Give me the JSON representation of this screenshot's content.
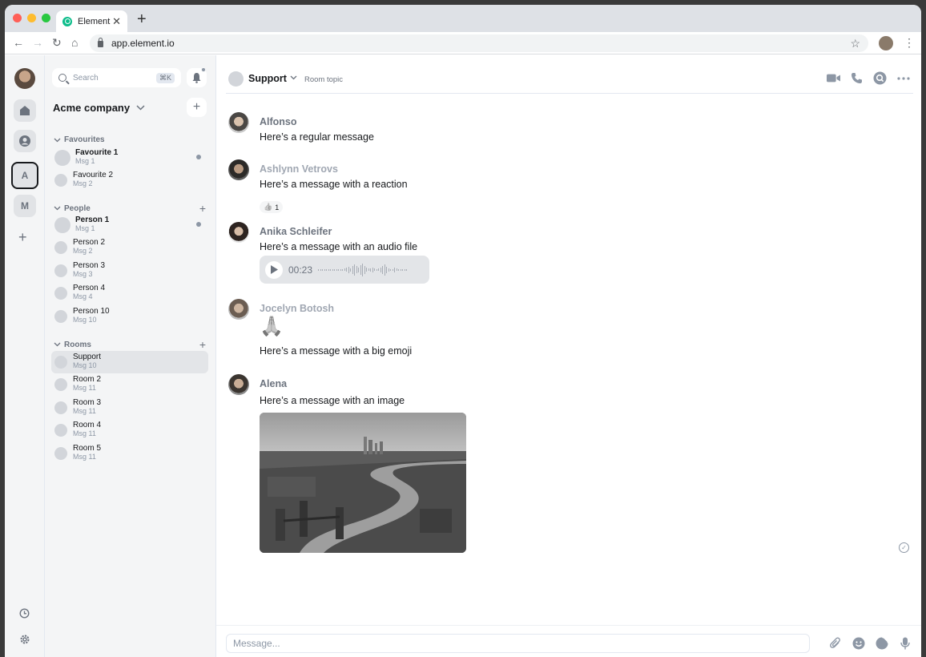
{
  "browser": {
    "tab_title": "Element",
    "tab_close": "✕",
    "new_tab": "+",
    "url": "app.element.io",
    "traffic_lights": [
      "#ff5f57",
      "#febc2e",
      "#28c840"
    ]
  },
  "spaces": {
    "items": [
      {
        "label": "A"
      },
      {
        "label": "M"
      }
    ],
    "add": "+"
  },
  "sidebar": {
    "search_placeholder": "Search",
    "search_shortcut": "⌘K",
    "space_name": "Acme company",
    "sections": {
      "favourites": "Favourites",
      "people": "People",
      "rooms": "Rooms"
    },
    "favourites": [
      {
        "name": "Favourite 1",
        "msg": "Msg 1"
      },
      {
        "name": "Favourite 2",
        "msg": "Msg 2"
      }
    ],
    "people": [
      {
        "name": "Person 1",
        "msg": "Msg 1"
      },
      {
        "name": "Person 2",
        "msg": "Msg 2"
      },
      {
        "name": "Person 3",
        "msg": "Msg 3"
      },
      {
        "name": "Person 4",
        "msg": "Msg 4"
      },
      {
        "name": "Person 10",
        "msg": "Msg 10"
      }
    ],
    "rooms": [
      {
        "name": "Support",
        "msg": "Msg 10"
      },
      {
        "name": "Room 2",
        "msg": "Msg 11"
      },
      {
        "name": "Room 3",
        "msg": "Msg 11"
      },
      {
        "name": "Room 4",
        "msg": "Msg 11"
      },
      {
        "name": "Room 5",
        "msg": "Msg 11"
      }
    ]
  },
  "room": {
    "name": "Support",
    "topic": "Room topic"
  },
  "messages": [
    {
      "sender": "Alfonso",
      "body": "Here’s a regular message"
    },
    {
      "sender": "Ashlynn Vetrovs",
      "body": "Here’s a message with a reaction",
      "reaction_emoji": "👍",
      "reaction_count": "1"
    },
    {
      "sender": "Anika Schleifer",
      "body": "Here’s a message with an audio file",
      "audio_duration": "00:23"
    },
    {
      "sender": "Jocelyn Botosh",
      "body": "Here’s a message with a big emoji",
      "emoji": "🙏"
    },
    {
      "sender": "Alena",
      "body": "Here’s a message with an image"
    }
  ],
  "composer": {
    "placeholder": "Message..."
  },
  "colors": {
    "accent": "#0dbd8b",
    "text_primary": "#17191c",
    "text_secondary": "#6c737e",
    "sidebar_bg": "#f4f5f6",
    "selected_room_bg": "#e3e5e8"
  }
}
